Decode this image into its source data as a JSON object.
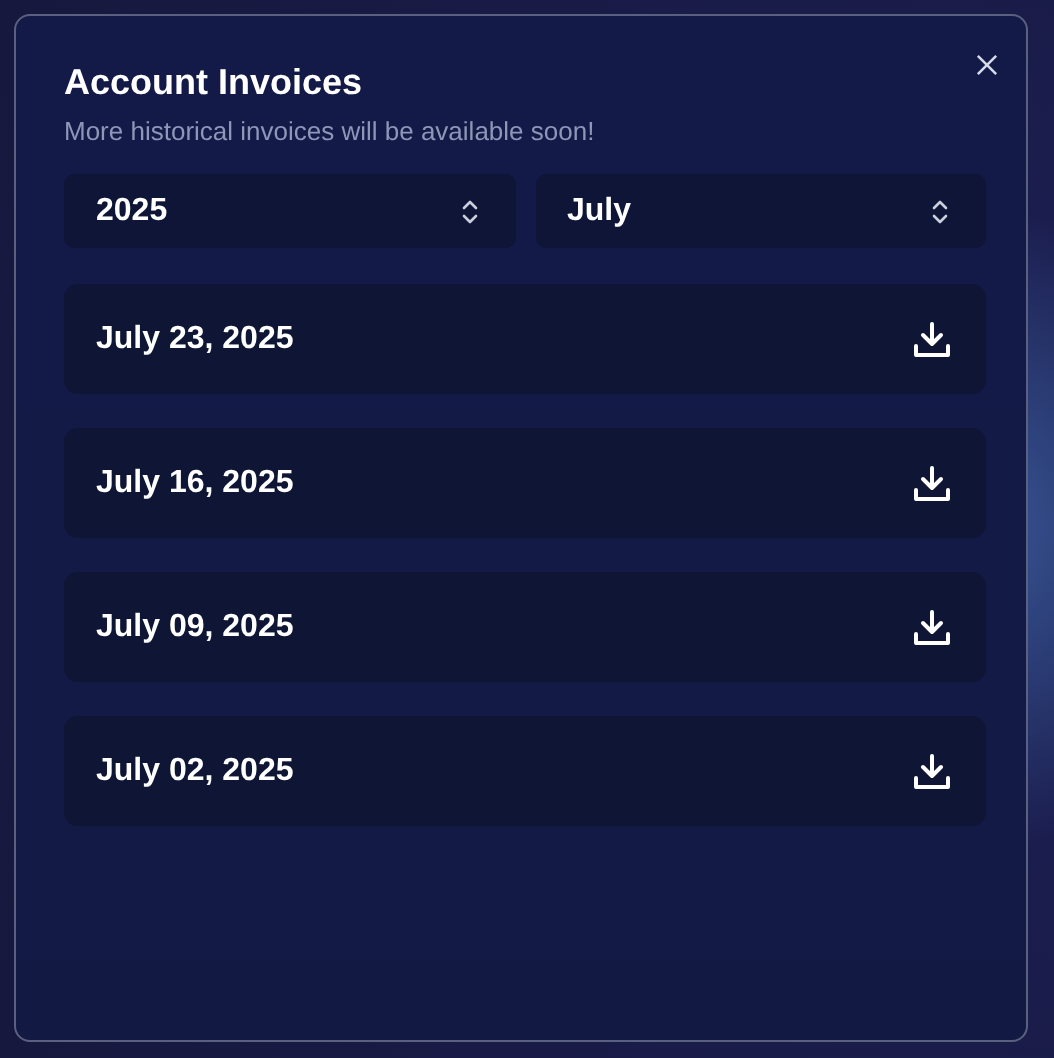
{
  "dialog": {
    "title": "Account Invoices",
    "subtitle": "More historical invoices will be available soon!"
  },
  "filters": [
    {
      "value": "2025"
    },
    {
      "value": "July"
    }
  ],
  "invoices": [
    {
      "date": "July 23, 2025"
    },
    {
      "date": "July 16, 2025"
    },
    {
      "date": "July 09, 2025"
    },
    {
      "date": "July 02, 2025"
    }
  ]
}
